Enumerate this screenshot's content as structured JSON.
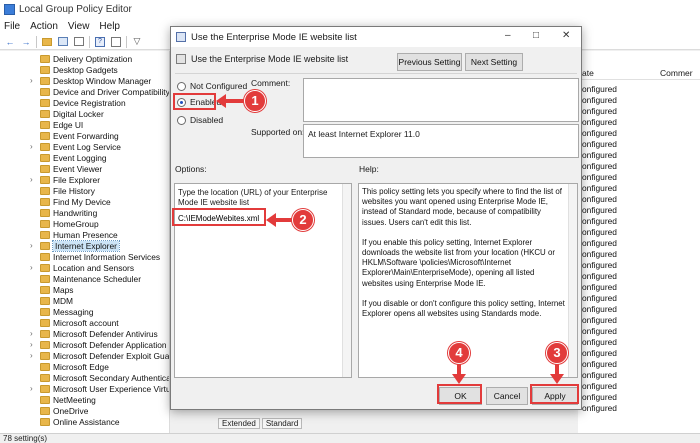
{
  "window": {
    "title": "Local Group Policy Editor"
  },
  "menu": [
    "File",
    "Action",
    "View",
    "Help"
  ],
  "toolbar_icons": [
    "back-icon",
    "forward-icon",
    "folder-up-icon",
    "console-tree-icon",
    "export-icon",
    "help-icon",
    "properties-icon",
    "filter-icon"
  ],
  "tree": {
    "items": [
      {
        "label": "Delivery Optimization",
        "chevron": false
      },
      {
        "label": "Desktop Gadgets",
        "chevron": false
      },
      {
        "label": "Desktop Window Manager",
        "chevron": true
      },
      {
        "label": "Device and Driver Compatibility",
        "chevron": false
      },
      {
        "label": "Device Registration",
        "chevron": false
      },
      {
        "label": "Digital Locker",
        "chevron": false
      },
      {
        "label": "Edge UI",
        "chevron": false
      },
      {
        "label": "Event Forwarding",
        "chevron": false
      },
      {
        "label": "Event Log Service",
        "chevron": true
      },
      {
        "label": "Event Logging",
        "chevron": false
      },
      {
        "label": "Event Viewer",
        "chevron": false
      },
      {
        "label": "File Explorer",
        "chevron": true
      },
      {
        "label": "File History",
        "chevron": false
      },
      {
        "label": "Find My Device",
        "chevron": false
      },
      {
        "label": "Handwriting",
        "chevron": false
      },
      {
        "label": "HomeGroup",
        "chevron": false
      },
      {
        "label": "Human Presence",
        "chevron": false
      },
      {
        "label": "Internet Explorer",
        "chevron": true,
        "selected": true
      },
      {
        "label": "Internet Information Services",
        "chevron": false
      },
      {
        "label": "Location and Sensors",
        "chevron": true
      },
      {
        "label": "Maintenance Scheduler",
        "chevron": false
      },
      {
        "label": "Maps",
        "chevron": false
      },
      {
        "label": "MDM",
        "chevron": false
      },
      {
        "label": "Messaging",
        "chevron": false
      },
      {
        "label": "Microsoft account",
        "chevron": false
      },
      {
        "label": "Microsoft Defender Antivirus",
        "chevron": true
      },
      {
        "label": "Microsoft Defender Application Gu",
        "chevron": true
      },
      {
        "label": "Microsoft Defender Exploit Guard",
        "chevron": true
      },
      {
        "label": "Microsoft Edge",
        "chevron": false
      },
      {
        "label": "Microsoft Secondary Authenticatic",
        "chevron": false
      },
      {
        "label": "Microsoft User Experience Virtuali",
        "chevron": true
      },
      {
        "label": "NetMeeting",
        "chevron": false
      },
      {
        "label": "OneDrive",
        "chevron": false
      },
      {
        "label": "Online Assistance",
        "chevron": false
      }
    ]
  },
  "list": {
    "header_state": "ate",
    "header_comment": "Commer",
    "rows": [
      "onfigured",
      "onfigured",
      "onfigured",
      "onfigured",
      "onfigured",
      "onfigured",
      "onfigured",
      "onfigured",
      "onfigured",
      "onfigured",
      "onfigured",
      "onfigured",
      "onfigured",
      "onfigured",
      "onfigured",
      "onfigured",
      "onfigured",
      "onfigured",
      "onfigured",
      "onfigured",
      "onfigured",
      "onfigured",
      "onfigured",
      "onfigured",
      "onfigured",
      "onfigured",
      "onfigured",
      "onfigured",
      "onfigured",
      "onfigured"
    ]
  },
  "bottom_tabs": [
    "Extended",
    "Standard"
  ],
  "status": "78 setting(s)",
  "dialog": {
    "title": "Use the Enterprise Mode IE website list",
    "subtitle": "Use the Enterprise Mode IE website list",
    "prev_label": "Previous Setting",
    "next_label": "Next Setting",
    "radio_not_configured": "Not Configured",
    "radio_enabled": "Enabled",
    "radio_disabled": "Disabled",
    "selected_state": "Enabled",
    "comment_label": "Comment:",
    "supported_label": "Supported on:",
    "supported_value": "At least Internet Explorer 11.0",
    "options_label": "Options:",
    "help_label": "Help:",
    "option_prompt": "Type the location (URL) of your Enterprise Mode IE website list",
    "url_value": "C:\\IEModeWebites.xml",
    "help_paragraphs": [
      "This policy setting lets you specify where to find the list of websites you want opened using Enterprise Mode IE, instead of Standard mode, because of compatibility issues. Users can't edit this list.",
      "If you enable this policy setting, Internet Explorer downloads the website list from your location (HKCU or HKLM\\Software \\policies\\Microsoft\\Internet Explorer\\Main\\EnterpriseMode), opening all listed websites using Enterprise Mode IE.",
      "If you disable or don't configure this policy setting, Internet Explorer opens all websites using Standards mode."
    ],
    "ok_label": "OK",
    "cancel_label": "Cancel",
    "apply_label": "Apply"
  },
  "annotations": {
    "step_enable": "1",
    "step_url": "2",
    "step_apply": "3",
    "step_ok": "4",
    "color": "#e23b3b"
  }
}
